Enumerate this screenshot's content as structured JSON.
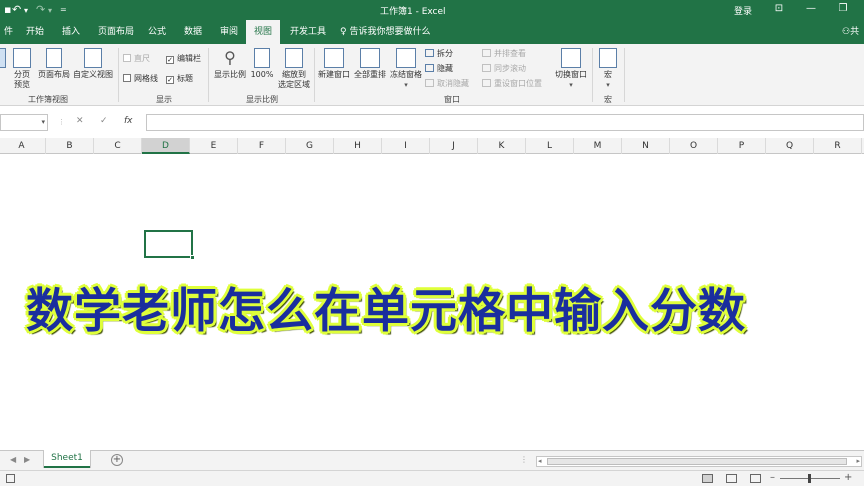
{
  "titlebar": {
    "title": "工作簿1 - Excel",
    "login": "登录",
    "share": "共"
  },
  "tabs": [
    {
      "label": "件",
      "active": false
    },
    {
      "label": "开始",
      "active": false
    },
    {
      "label": "插入",
      "active": false
    },
    {
      "label": "页面布局",
      "active": false
    },
    {
      "label": "公式",
      "active": false
    },
    {
      "label": "数据",
      "active": false
    },
    {
      "label": "审阅",
      "active": false
    },
    {
      "label": "视图",
      "active": true
    },
    {
      "label": "开发工具",
      "active": false
    }
  ],
  "tell_me": "告诉我你想要做什么",
  "ribbon": {
    "workbook_views": {
      "group_label": "工作簿视图",
      "page_break_preview": "分页\n预览",
      "page_layout": "页面布局",
      "custom_views": "自定义视图"
    },
    "show": {
      "group_label": "显示",
      "ruler": "直尺",
      "gridlines": "网格线",
      "formula_bar": "编辑栏",
      "headings": "标题"
    },
    "zoom": {
      "group_label": "显示比例",
      "zoom": "显示比例",
      "hundred": "100%",
      "zoom_to_selection": "缩放到\n选定区域"
    },
    "window": {
      "group_label": "窗口",
      "new_window": "新建窗口",
      "arrange_all": "全部重排",
      "freeze_panes": "冻结窗格",
      "split": "拆分",
      "hide": "隐藏",
      "unhide": "取消隐藏",
      "view_side_by_side": "并排查看",
      "sync_scroll": "同步滚动",
      "reset_position": "重设窗口位置",
      "switch_windows": "切换窗口"
    },
    "macros": {
      "group_label": "宏",
      "macros": "宏"
    }
  },
  "formula_bar": {
    "cancel": "✕",
    "enter": "✓",
    "fx": "fx",
    "value": ""
  },
  "columns": [
    "A",
    "B",
    "C",
    "D",
    "E",
    "F",
    "G",
    "H",
    "I",
    "J",
    "K",
    "L",
    "M",
    "N",
    "O",
    "P",
    "Q",
    "R"
  ],
  "selected_column": "D",
  "headline": "数学老师怎么在单元格中输入分数",
  "sheets": [
    {
      "name": "Sheet1",
      "active": true
    }
  ],
  "add_sheet": "+"
}
